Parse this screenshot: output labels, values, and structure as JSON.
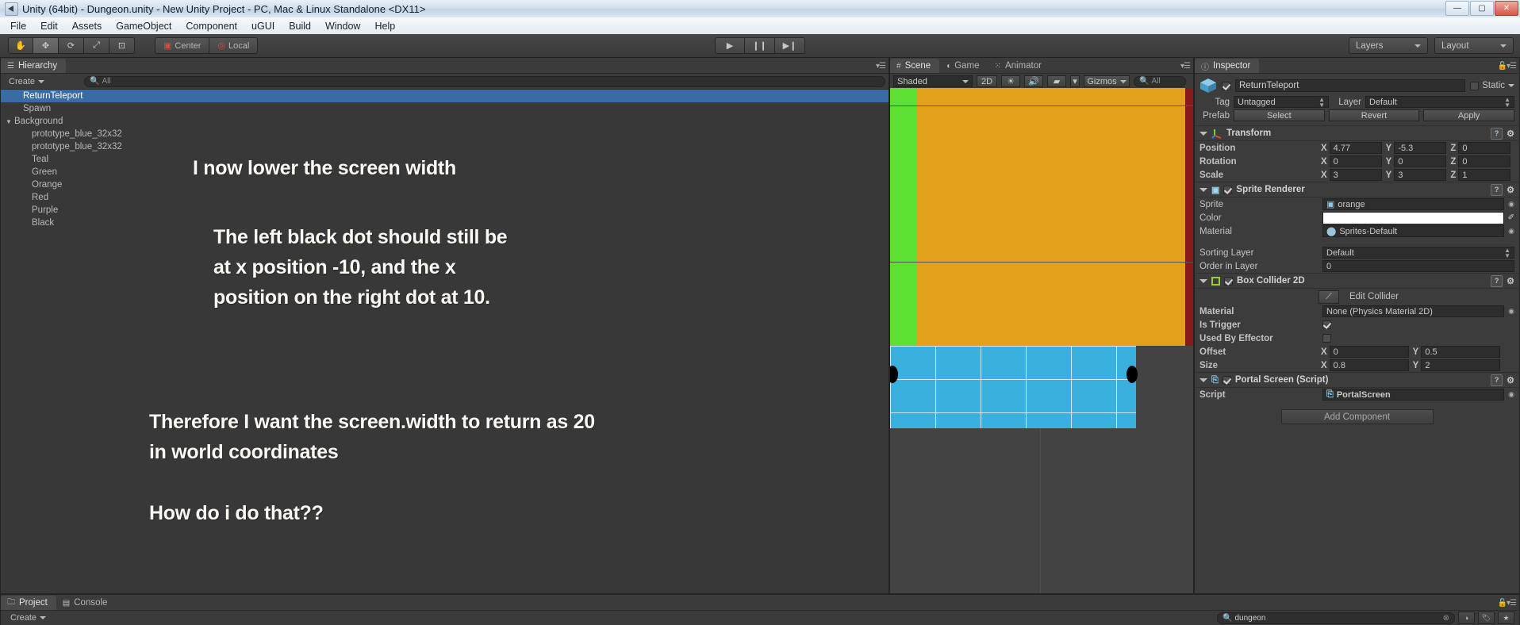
{
  "window": {
    "title": "Unity (64bit) - Dungeon.unity - New Unity Project - PC, Mac & Linux Standalone <DX11>",
    "minimize": "—",
    "maximize": "▢",
    "close": "✕"
  },
  "menubar": {
    "items": [
      "File",
      "Edit",
      "Assets",
      "GameObject",
      "Component",
      "uGUI",
      "Build",
      "Window",
      "Help"
    ]
  },
  "toolbar": {
    "tools": [
      {
        "name": "hand-tool",
        "glyph": "✋",
        "active": false
      },
      {
        "name": "move-tool",
        "glyph": "✥",
        "active": true
      },
      {
        "name": "rotate-tool",
        "glyph": "⟳",
        "active": false
      },
      {
        "name": "scale-tool",
        "glyph": "⤢",
        "active": false
      },
      {
        "name": "rect-tool",
        "glyph": "⊡",
        "active": false
      }
    ],
    "pivot": "Center",
    "pivot_rotation": "Local",
    "play": "▶",
    "pause": "❙❙",
    "step": "▶❙",
    "layers": "Layers",
    "layout": "Layout"
  },
  "hierarchy": {
    "tab": "Hierarchy",
    "create": "Create",
    "search_placeholder": "All",
    "items": [
      {
        "label": "ReturnTeleport",
        "indent": 1,
        "selected": true,
        "expander": ""
      },
      {
        "label": "Spawn",
        "indent": 1,
        "selected": false,
        "expander": ""
      },
      {
        "label": "Background",
        "indent": 0,
        "selected": false,
        "expander": "▼"
      },
      {
        "label": "prototype_blue_32x32",
        "indent": 2,
        "selected": false,
        "expander": ""
      },
      {
        "label": "prototype_blue_32x32",
        "indent": 2,
        "selected": false,
        "expander": ""
      },
      {
        "label": "Teal",
        "indent": 2,
        "selected": false,
        "expander": ""
      },
      {
        "label": "Green",
        "indent": 2,
        "selected": false,
        "expander": ""
      },
      {
        "label": "Orange",
        "indent": 2,
        "selected": false,
        "expander": ""
      },
      {
        "label": "Red",
        "indent": 2,
        "selected": false,
        "expander": ""
      },
      {
        "label": "Purple",
        "indent": 2,
        "selected": false,
        "expander": ""
      },
      {
        "label": "Black",
        "indent": 2,
        "selected": false,
        "expander": ""
      }
    ],
    "overlay_text": {
      "line1": "I now lower the screen width",
      "line2": "The left black dot should still be\nat x position -10, and the x\nposition on the right dot at 10.",
      "line3": "Therefore I want the screen.width to return as 20\nin world coordinates",
      "line4": "How do i do that??"
    }
  },
  "scene": {
    "tabs": [
      {
        "label": "Scene",
        "icon": "grid-icon",
        "active": true
      },
      {
        "label": "Game",
        "icon": "gamepad-icon",
        "active": false
      },
      {
        "label": "Animator",
        "icon": "animator-icon",
        "active": false
      }
    ],
    "draw_mode": "Shaded",
    "two_d": "2D",
    "gizmos": "Gizmos",
    "search_placeholder": "All",
    "colors": {
      "orange": "#e3a01b",
      "green": "#5ce033",
      "teal": "#39b0dd",
      "dark_red": "#8a1a19",
      "dot": "#000000",
      "background": "#434343"
    }
  },
  "inspector": {
    "tab": "Inspector",
    "object_name": "ReturnTeleport",
    "object_enabled": true,
    "static_label": "Static",
    "tag_label": "Tag",
    "tag_value": "Untagged",
    "layer_label": "Layer",
    "layer_value": "Default",
    "prefab_label": "Prefab",
    "prefab_select": "Select",
    "prefab_revert": "Revert",
    "prefab_apply": "Apply",
    "transform": {
      "title": "Transform",
      "rows": [
        {
          "label": "Position",
          "x": "4.77",
          "y": "-5.3",
          "z": "0"
        },
        {
          "label": "Rotation",
          "x": "0",
          "y": "0",
          "z": "0"
        },
        {
          "label": "Scale",
          "x": "3",
          "y": "3",
          "z": "1"
        }
      ]
    },
    "sprite_renderer": {
      "title": "Sprite Renderer",
      "enabled": true,
      "sprite_label": "Sprite",
      "sprite_value": "orange",
      "color_label": "Color",
      "color_value": "#ffffff",
      "material_label": "Material",
      "material_value": "Sprites-Default",
      "sorting_layer_label": "Sorting Layer",
      "sorting_layer_value": "Default",
      "order_in_layer_label": "Order in Layer",
      "order_in_layer_value": "0"
    },
    "box_collider": {
      "title": "Box Collider 2D",
      "enabled": true,
      "edit_collider": "Edit Collider",
      "material_label": "Material",
      "material_value": "None (Physics Material 2D)",
      "is_trigger_label": "Is Trigger",
      "is_trigger": true,
      "used_by_effector_label": "Used By Effector",
      "used_by_effector": false,
      "offset_label": "Offset",
      "offset_x": "0",
      "offset_y": "0.5",
      "size_label": "Size",
      "size_x": "0.8",
      "size_y": "2"
    },
    "portal_script": {
      "title": "Portal Screen (Script)",
      "enabled": true,
      "script_label": "Script",
      "script_value": "PortalScreen"
    },
    "add_component": "Add Component"
  },
  "project": {
    "tabs": [
      {
        "label": "Project",
        "icon": "folder-icon",
        "active": true
      },
      {
        "label": "Console",
        "icon": "console-icon",
        "active": false
      }
    ],
    "create": "Create",
    "search_value": "dungeon",
    "filter_icons": [
      "type-filter-icon",
      "label-filter-icon",
      "favorite-icon"
    ]
  }
}
